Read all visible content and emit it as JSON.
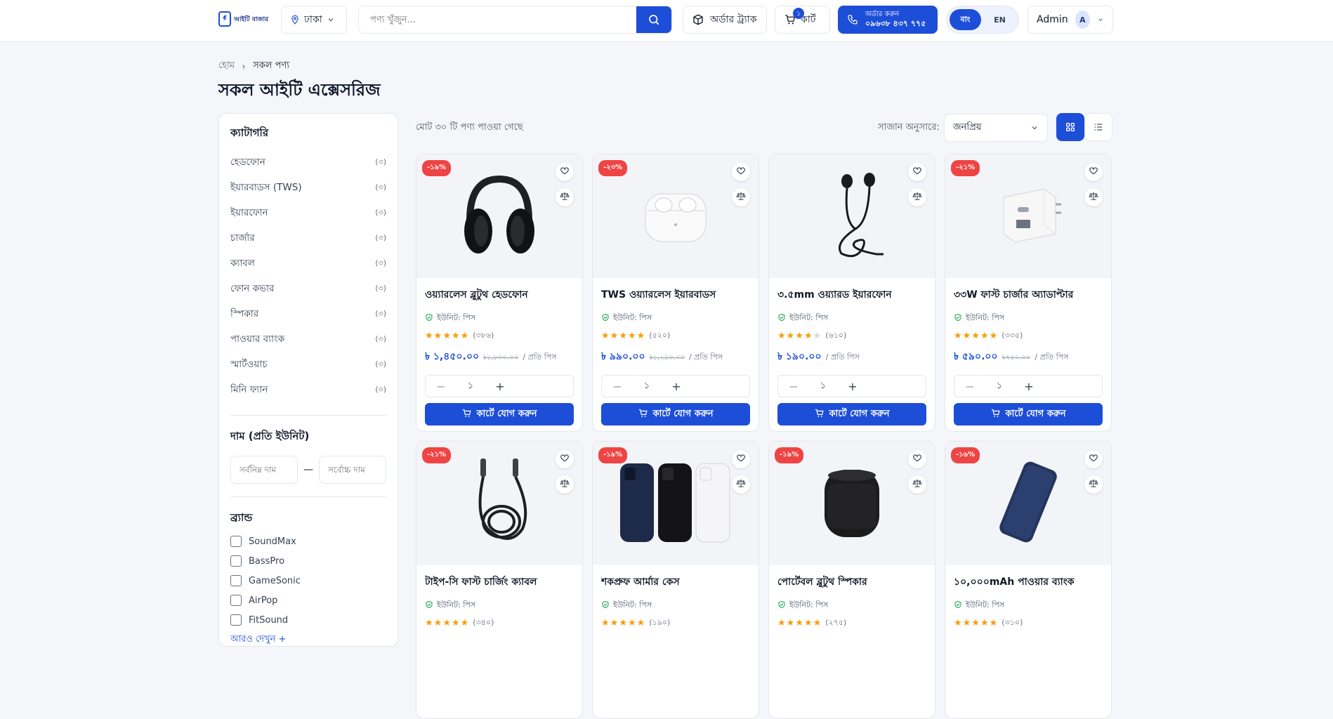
{
  "header": {
    "logo_text": "আইটি বাজার",
    "location": "ঢাকা",
    "search_placeholder": "পণ্য খুঁজুন...",
    "track_label": "অর্ডার ট্র্যাক",
    "cart_label": "কার্ট",
    "cart_count": "১",
    "order_line1": "অর্ডার করুন",
    "order_line2": "০৯৬৩৮ ৪৩৭ ৭৭৫",
    "lang_bn": "বাং",
    "lang_en": "EN",
    "user_name": "Admin",
    "user_initial": "A"
  },
  "breadcrumb": {
    "home": "হোম",
    "current": "সকল পণ্য"
  },
  "page_title": "সকল আইটি এক্সেসরিজ",
  "sidebar": {
    "categories_title": "ক্যাটাগরি",
    "categories": [
      {
        "label": "হেডফোন",
        "count": "(৩)"
      },
      {
        "label": "ইয়ারবাডস (TWS)",
        "count": "(৩)"
      },
      {
        "label": "ইয়ারফোন",
        "count": "(৩)"
      },
      {
        "label": "চার্জার",
        "count": "(৩)"
      },
      {
        "label": "ক্যাবল",
        "count": "(৩)"
      },
      {
        "label": "ফোন কভার",
        "count": "(৩)"
      },
      {
        "label": "স্পিকার",
        "count": "(৩)"
      },
      {
        "label": "পাওয়ার ব্যাংক",
        "count": "(৩)"
      },
      {
        "label": "স্মার্টওয়াচ",
        "count": "(৩)"
      },
      {
        "label": "মিনি ফ্যান",
        "count": "(৩)"
      }
    ],
    "price_title": "দাম (প্রতি ইউনিট)",
    "min_placeholder": "সর্বনিম্ন দাম",
    "max_placeholder": "সর্বোচ্চ দাম",
    "price_dash": "—",
    "brand_title": "ব্র্যান্ড",
    "brands": [
      "SoundMax",
      "BassPro",
      "GameSonic",
      "AirPop",
      "FitSound"
    ],
    "more_label": "আরও দেখুন +"
  },
  "toolbar": {
    "result_count": "মোট ৩০ টি পণ্য পাওয়া গেছে",
    "sort_label": "সাজান অনুসারে:",
    "sort_value": "জনপ্রিয়"
  },
  "colors": {
    "accent": "#1d4ed8",
    "discount": "#ef4444",
    "star": "#f59e0b"
  },
  "common": {
    "unit": "ইউনিট: পিস",
    "currency": "৳",
    "per_unit": "/ প্রতি পিস",
    "qty": "১",
    "add_to_cart": "কার্টে যোগ করুন"
  },
  "products": [
    {
      "name": "ওয়্যারলেস ব্লুটুথ হেডফোন",
      "discount": "-১৯%",
      "rating": 5,
      "reviews": "(৩৮৬)",
      "price": "৳ ১,৪৫০.০০",
      "old_price": "৳১,৮০০.০০",
      "icon": "headphone-image"
    },
    {
      "name": "TWS ওয়্যারলেস ইয়ারবাডস",
      "discount": "-২৩%",
      "rating": 5,
      "reviews": "(৫২০)",
      "price": "৳ ৯৯০.০০",
      "old_price": "৳১,২৯০.০০",
      "icon": "earbuds-image"
    },
    {
      "name": "৩.৫mm ওয়্যারড ইয়ারফোন",
      "discount": "",
      "rating": 4,
      "reviews": "(৬১০)",
      "price": "৳ ১৯০.০০",
      "old_price": "",
      "icon": "earphone-image"
    },
    {
      "name": "৩৩W ফাস্ট চার্জার অ্যাডাপ্টার",
      "discount": "-২১%",
      "rating": 5,
      "reviews": "(৩৩৫)",
      "price": "৳ ৫৯০.০০",
      "old_price": "৳৭৫০.০০",
      "icon": "charger-image"
    },
    {
      "name": "টাইপ-সি ফাস্ট চার্জিং ক্যাবল",
      "discount": "-২১%",
      "rating": 5,
      "reviews": "(৩৪০)",
      "price": "",
      "old_price": "",
      "icon": "cable-image"
    },
    {
      "name": "শকপ্রুফ আর্মার কেস",
      "discount": "-১৯%",
      "rating": 5,
      "reviews": "(১৯০)",
      "price": "",
      "old_price": "",
      "icon": "phone-case-image"
    },
    {
      "name": "পোর্টেবল ব্লুটুথ স্পিকার",
      "discount": "-১৯%",
      "rating": 5,
      "reviews": "(২৭৫)",
      "price": "",
      "old_price": "",
      "icon": "speaker-image"
    },
    {
      "name": "১০,০০০mAh পাওয়ার ব্যাংক",
      "discount": "-১৬%",
      "rating": 5,
      "reviews": "(৩১০)",
      "price": "",
      "old_price": "",
      "icon": "power-bank-image"
    }
  ]
}
